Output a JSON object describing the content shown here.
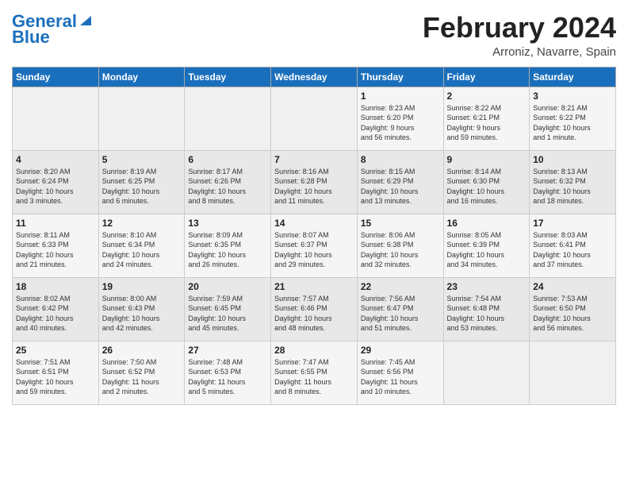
{
  "header": {
    "logo_line1": "General",
    "logo_line2": "Blue",
    "month_title": "February 2024",
    "location": "Arroniz, Navarre, Spain"
  },
  "weekdays": [
    "Sunday",
    "Monday",
    "Tuesday",
    "Wednesday",
    "Thursday",
    "Friday",
    "Saturday"
  ],
  "weeks": [
    [
      {
        "day": "",
        "info": ""
      },
      {
        "day": "",
        "info": ""
      },
      {
        "day": "",
        "info": ""
      },
      {
        "day": "",
        "info": ""
      },
      {
        "day": "1",
        "info": "Sunrise: 8:23 AM\nSunset: 6:20 PM\nDaylight: 9 hours\nand 56 minutes."
      },
      {
        "day": "2",
        "info": "Sunrise: 8:22 AM\nSunset: 6:21 PM\nDaylight: 9 hours\nand 59 minutes."
      },
      {
        "day": "3",
        "info": "Sunrise: 8:21 AM\nSunset: 6:22 PM\nDaylight: 10 hours\nand 1 minute."
      }
    ],
    [
      {
        "day": "4",
        "info": "Sunrise: 8:20 AM\nSunset: 6:24 PM\nDaylight: 10 hours\nand 3 minutes."
      },
      {
        "day": "5",
        "info": "Sunrise: 8:19 AM\nSunset: 6:25 PM\nDaylight: 10 hours\nand 6 minutes."
      },
      {
        "day": "6",
        "info": "Sunrise: 8:17 AM\nSunset: 6:26 PM\nDaylight: 10 hours\nand 8 minutes."
      },
      {
        "day": "7",
        "info": "Sunrise: 8:16 AM\nSunset: 6:28 PM\nDaylight: 10 hours\nand 11 minutes."
      },
      {
        "day": "8",
        "info": "Sunrise: 8:15 AM\nSunset: 6:29 PM\nDaylight: 10 hours\nand 13 minutes."
      },
      {
        "day": "9",
        "info": "Sunrise: 8:14 AM\nSunset: 6:30 PM\nDaylight: 10 hours\nand 16 minutes."
      },
      {
        "day": "10",
        "info": "Sunrise: 8:13 AM\nSunset: 6:32 PM\nDaylight: 10 hours\nand 18 minutes."
      }
    ],
    [
      {
        "day": "11",
        "info": "Sunrise: 8:11 AM\nSunset: 6:33 PM\nDaylight: 10 hours\nand 21 minutes."
      },
      {
        "day": "12",
        "info": "Sunrise: 8:10 AM\nSunset: 6:34 PM\nDaylight: 10 hours\nand 24 minutes."
      },
      {
        "day": "13",
        "info": "Sunrise: 8:09 AM\nSunset: 6:35 PM\nDaylight: 10 hours\nand 26 minutes."
      },
      {
        "day": "14",
        "info": "Sunrise: 8:07 AM\nSunset: 6:37 PM\nDaylight: 10 hours\nand 29 minutes."
      },
      {
        "day": "15",
        "info": "Sunrise: 8:06 AM\nSunset: 6:38 PM\nDaylight: 10 hours\nand 32 minutes."
      },
      {
        "day": "16",
        "info": "Sunrise: 8:05 AM\nSunset: 6:39 PM\nDaylight: 10 hours\nand 34 minutes."
      },
      {
        "day": "17",
        "info": "Sunrise: 8:03 AM\nSunset: 6:41 PM\nDaylight: 10 hours\nand 37 minutes."
      }
    ],
    [
      {
        "day": "18",
        "info": "Sunrise: 8:02 AM\nSunset: 6:42 PM\nDaylight: 10 hours\nand 40 minutes."
      },
      {
        "day": "19",
        "info": "Sunrise: 8:00 AM\nSunset: 6:43 PM\nDaylight: 10 hours\nand 42 minutes."
      },
      {
        "day": "20",
        "info": "Sunrise: 7:59 AM\nSunset: 6:45 PM\nDaylight: 10 hours\nand 45 minutes."
      },
      {
        "day": "21",
        "info": "Sunrise: 7:57 AM\nSunset: 6:46 PM\nDaylight: 10 hours\nand 48 minutes."
      },
      {
        "day": "22",
        "info": "Sunrise: 7:56 AM\nSunset: 6:47 PM\nDaylight: 10 hours\nand 51 minutes."
      },
      {
        "day": "23",
        "info": "Sunrise: 7:54 AM\nSunset: 6:48 PM\nDaylight: 10 hours\nand 53 minutes."
      },
      {
        "day": "24",
        "info": "Sunrise: 7:53 AM\nSunset: 6:50 PM\nDaylight: 10 hours\nand 56 minutes."
      }
    ],
    [
      {
        "day": "25",
        "info": "Sunrise: 7:51 AM\nSunset: 6:51 PM\nDaylight: 10 hours\nand 59 minutes."
      },
      {
        "day": "26",
        "info": "Sunrise: 7:50 AM\nSunset: 6:52 PM\nDaylight: 11 hours\nand 2 minutes."
      },
      {
        "day": "27",
        "info": "Sunrise: 7:48 AM\nSunset: 6:53 PM\nDaylight: 11 hours\nand 5 minutes."
      },
      {
        "day": "28",
        "info": "Sunrise: 7:47 AM\nSunset: 6:55 PM\nDaylight: 11 hours\nand 8 minutes."
      },
      {
        "day": "29",
        "info": "Sunrise: 7:45 AM\nSunset: 6:56 PM\nDaylight: 11 hours\nand 10 minutes."
      },
      {
        "day": "",
        "info": ""
      },
      {
        "day": "",
        "info": ""
      }
    ]
  ]
}
